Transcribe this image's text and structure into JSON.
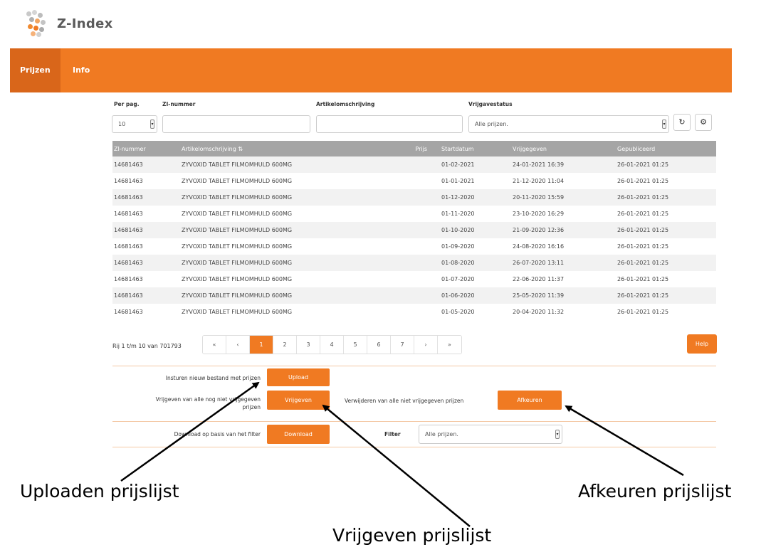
{
  "brand": {
    "name": "Z-Index"
  },
  "nav": {
    "items": [
      "Prijzen",
      "Info"
    ]
  },
  "filters": {
    "labels": {
      "per_page": "Per pag.",
      "zi_number": "ZI-nummer",
      "article": "Artikelomschrijving",
      "status": "Vrijgavestatus"
    },
    "per_page_value": "10",
    "zi_number_value": "",
    "article_value": "",
    "status_value": "Alle prijzen."
  },
  "table": {
    "columns": [
      "ZI-nummer",
      "Artikelomschrijving ⇅",
      "Prijs",
      "Startdatum",
      "Vrijgegeven",
      "Gepubliceerd"
    ],
    "rows": [
      [
        "14681463",
        "ZYVOXID TABLET FILMOMHULD 600MG",
        "",
        "01-02-2021",
        "24-01-2021 16:39",
        "26-01-2021 01:25"
      ],
      [
        "14681463",
        "ZYVOXID TABLET FILMOMHULD 600MG",
        "",
        "01-01-2021",
        "21-12-2020 11:04",
        "26-01-2021 01:25"
      ],
      [
        "14681463",
        "ZYVOXID TABLET FILMOMHULD 600MG",
        "",
        "01-12-2020",
        "20-11-2020 15:59",
        "26-01-2021 01:25"
      ],
      [
        "14681463",
        "ZYVOXID TABLET FILMOMHULD 600MG",
        "",
        "01-11-2020",
        "23-10-2020 16:29",
        "26-01-2021 01:25"
      ],
      [
        "14681463",
        "ZYVOXID TABLET FILMOMHULD 600MG",
        "",
        "01-10-2020",
        "21-09-2020 12:36",
        "26-01-2021 01:25"
      ],
      [
        "14681463",
        "ZYVOXID TABLET FILMOMHULD 600MG",
        "",
        "01-09-2020",
        "24-08-2020 16:16",
        "26-01-2021 01:25"
      ],
      [
        "14681463",
        "ZYVOXID TABLET FILMOMHULD 600MG",
        "",
        "01-08-2020",
        "26-07-2020 13:11",
        "26-01-2021 01:25"
      ],
      [
        "14681463",
        "ZYVOXID TABLET FILMOMHULD 600MG",
        "",
        "01-07-2020",
        "22-06-2020 11:37",
        "26-01-2021 01:25"
      ],
      [
        "14681463",
        "ZYVOXID TABLET FILMOMHULD 600MG",
        "",
        "01-06-2020",
        "25-05-2020 11:39",
        "26-01-2021 01:25"
      ],
      [
        "14681463",
        "ZYVOXID TABLET FILMOMHULD 600MG",
        "",
        "01-05-2020",
        "20-04-2020 11:32",
        "26-01-2021 01:25"
      ]
    ]
  },
  "pagination": {
    "info": "Rij 1 t/m 10 van 701793",
    "buttons": [
      "«",
      "‹",
      "1",
      "2",
      "3",
      "4",
      "5",
      "6",
      "7",
      "›",
      "»"
    ],
    "active": "1",
    "help_label": "Help"
  },
  "actions": {
    "upload_text": "Insturen nieuw bestand met prijzen",
    "upload_button": "Upload",
    "release_text_1": "Vrijgeven van alle nog niet vrijgegeven",
    "release_text_2": "prijzen",
    "release_button": "Vrijgeven",
    "reject_text": "Verwijderen van alle niet vrijgegeven prijzen",
    "reject_button": "Afkeuren",
    "download_text": "Download op basis van het filter",
    "download_button": "Download",
    "filter_label": "Filter",
    "filter_value": "Alle prijzen."
  },
  "annotations": {
    "upload": "Uploaden prijslijst",
    "release": "Vrijgeven prijslijst",
    "reject": "Afkeuren prijslijst"
  },
  "colors": {
    "accent": "#f07a22",
    "accent_dark": "#d9661a",
    "table_header": "#a5a5a5"
  }
}
